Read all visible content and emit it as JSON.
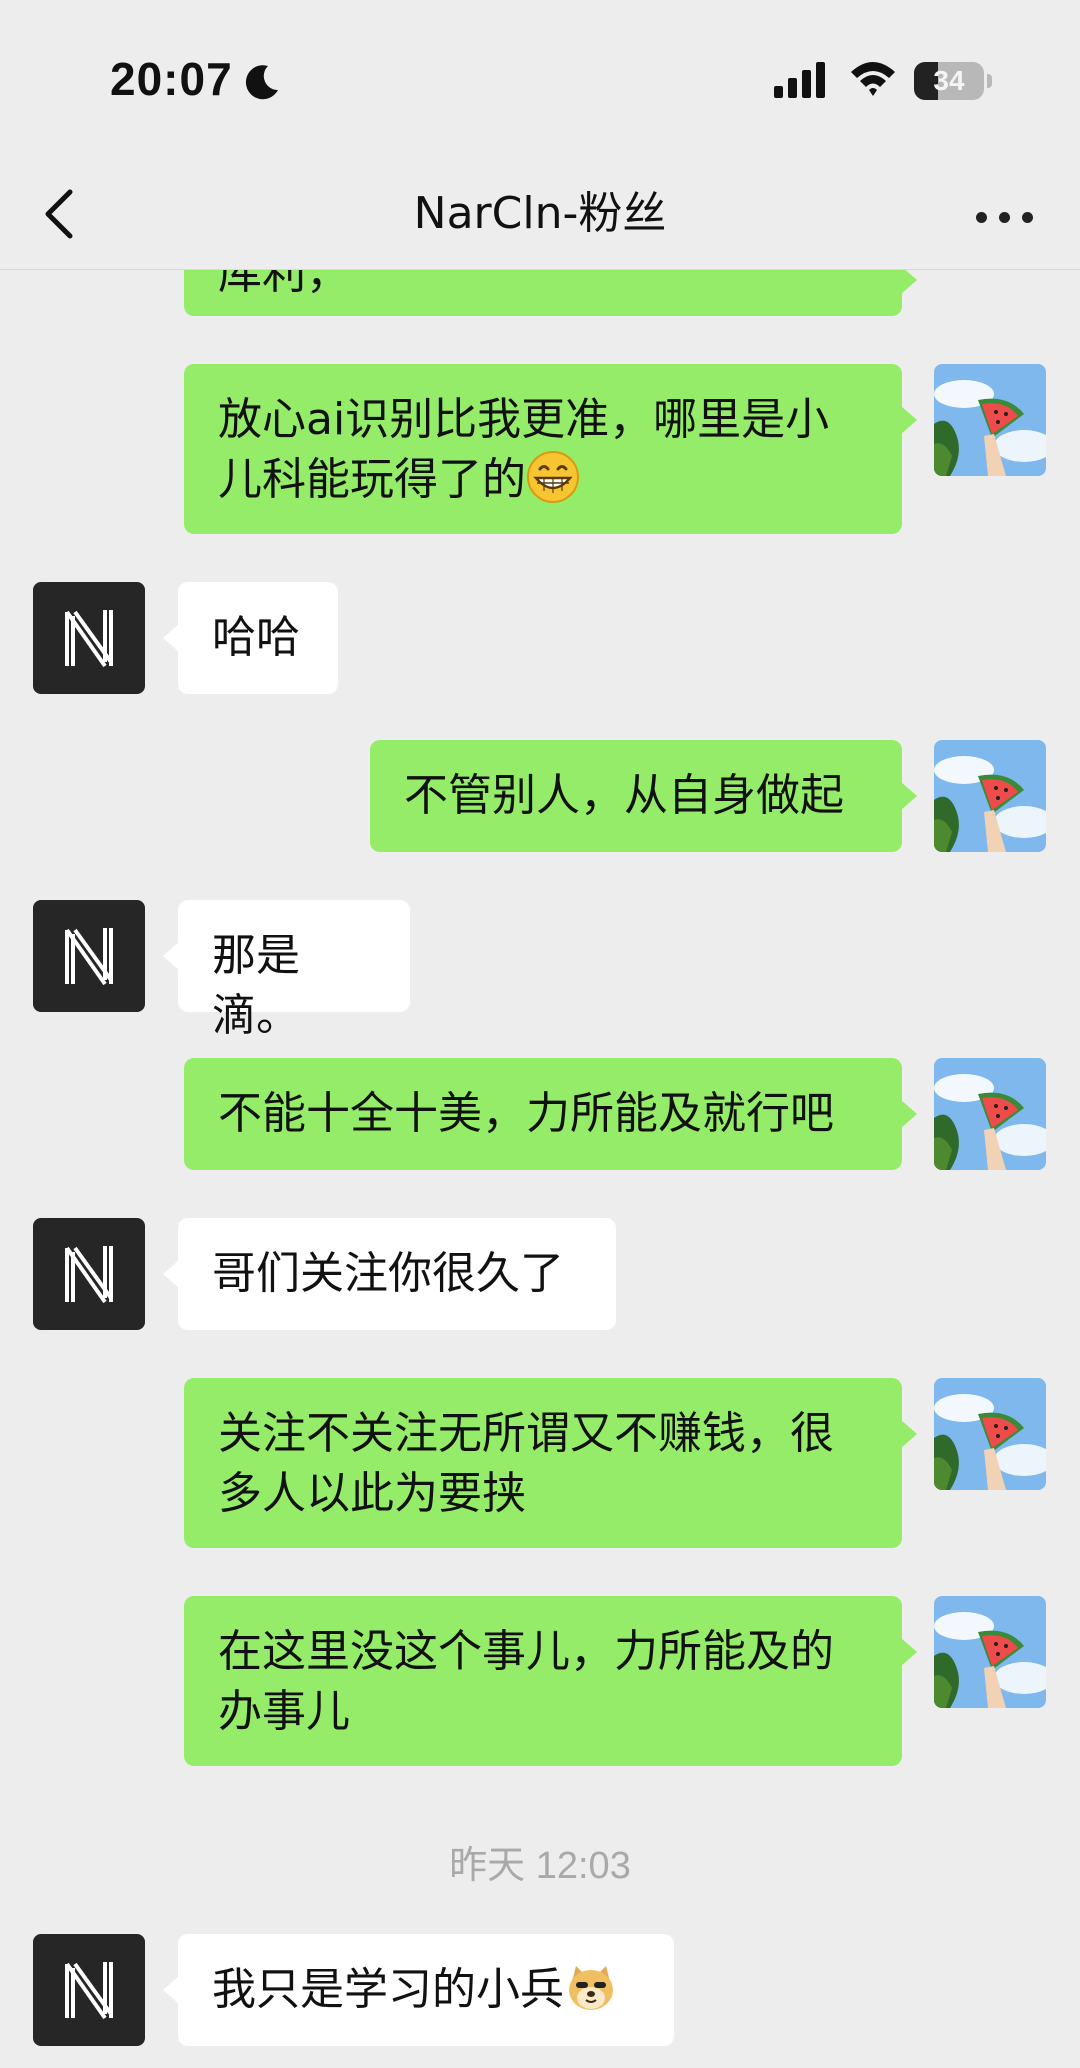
{
  "status_bar": {
    "time": "20:07",
    "battery_level": "34",
    "battery_fraction": 0.34,
    "icons": [
      "moon-icon",
      "signal-icon",
      "wifi-icon",
      "battery-icon"
    ]
  },
  "nav": {
    "title": "NarCln-粉丝",
    "back_icon": "chevron-left-icon",
    "more_icon": "more-dots-icon"
  },
  "messages": [
    {
      "from": "me",
      "text": "库利，"
    },
    {
      "from": "me",
      "text_line1": "放心ai识别比我更准，哪里是小",
      "text_line2": "儿科能玩得了的",
      "emoji": "grinning-face-emoji"
    },
    {
      "from": "them",
      "text": "哈哈"
    },
    {
      "from": "me",
      "text": "不管别人，从自身做起"
    },
    {
      "from": "them",
      "text": "那是滴。"
    },
    {
      "from": "me",
      "text": "不能十全十美，力所能及就行吧"
    },
    {
      "from": "them",
      "text": "哥们关注你很久了"
    },
    {
      "from": "me",
      "text_line1": "关注不关注无所谓又不赚钱，很",
      "text_line2": "多人以此为要挟"
    },
    {
      "from": "me",
      "text_line1": "在这里没这个事儿，力所能及的",
      "text_line2": "办事儿"
    },
    {
      "from": "them",
      "text": "我只是学习的小兵",
      "emoji": "doge-emoji"
    }
  ],
  "timestamp": "昨天 12:03",
  "colors": {
    "background": "#ededed",
    "my_bubble": "#95ec69",
    "their_bubble": "#ffffff",
    "their_avatar": "#262626"
  }
}
